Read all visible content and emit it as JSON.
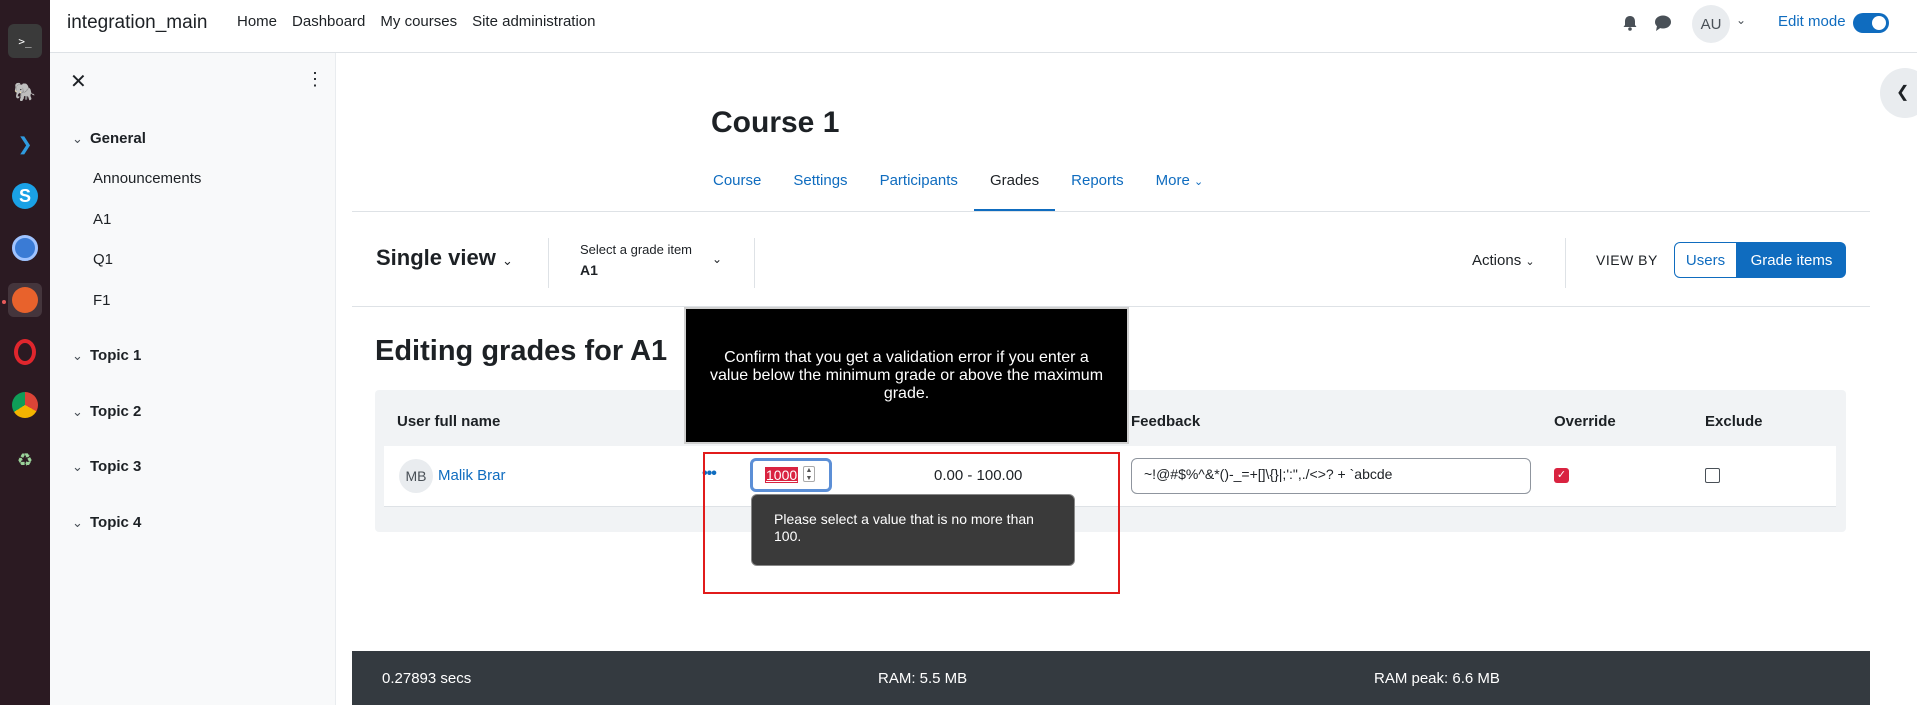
{
  "navbar": {
    "brand": "integration_main",
    "links": [
      "Home",
      "Dashboard",
      "My courses",
      "Site administration"
    ],
    "avatar_initials": "AU",
    "edit_mode_label": "Edit mode"
  },
  "drawer": {
    "sections": [
      {
        "title": "General",
        "items": [
          "Announcements",
          "A1",
          "Q1",
          "F1"
        ]
      },
      {
        "title": "Topic 1"
      },
      {
        "title": "Topic 2"
      },
      {
        "title": "Topic 3"
      },
      {
        "title": "Topic 4"
      }
    ]
  },
  "course": {
    "title": "Course 1",
    "tabs": [
      "Course",
      "Settings",
      "Participants",
      "Grades",
      "Reports",
      "More"
    ]
  },
  "toolbar": {
    "view_title": "Single view",
    "grade_item_label": "Select a grade item",
    "grade_item_value": "A1",
    "actions_label": "Actions",
    "view_by_label": "VIEW BY",
    "users_button": "Users",
    "grade_items_button": "Grade items"
  },
  "main": {
    "heading": "Editing grades for A1",
    "columns": {
      "user": "User full name",
      "feedback": "Feedback",
      "override": "Override",
      "exclude": "Exclude"
    },
    "row": {
      "initials": "MB",
      "name": "Malik Brar",
      "grade_value": "1000",
      "range": "0.00 - 100.00",
      "feedback": "~!@#$%^&*()-_=+[]\\{}|;':\",./<>? + `abcde",
      "override_checked": true,
      "exclude_checked": false
    },
    "validation_tooltip": "Please select a value that is no more than 100."
  },
  "instruction_overlay": "Confirm that you get a validation error if you enter a value below the minimum grade or above the maximum grade.",
  "footer": {
    "time": "0.27893 secs",
    "ram": "RAM: 5.5 MB",
    "ram_peak": "RAM peak: 6.6 MB"
  }
}
